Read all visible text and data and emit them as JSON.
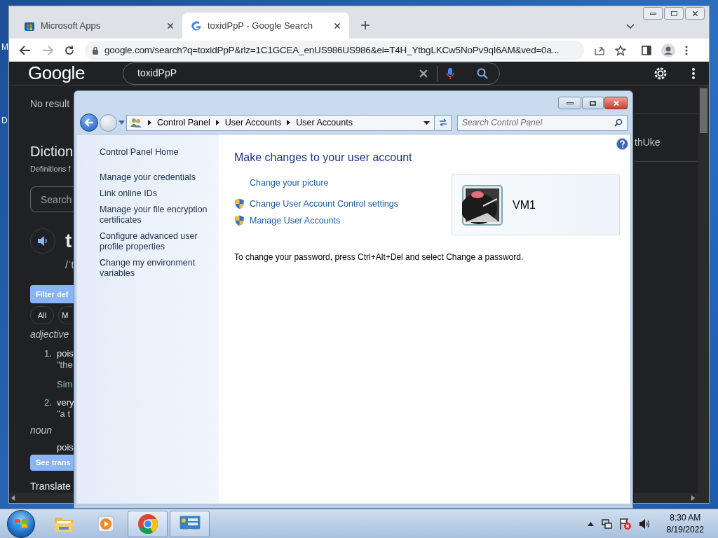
{
  "desktop": {
    "icon_labels": [
      "M",
      "D"
    ]
  },
  "browser": {
    "tabs": [
      {
        "label": "Microsoft Apps",
        "selected": false
      },
      {
        "label": "toxidPpP - Google Search",
        "selected": true
      }
    ],
    "url": "google.com/search?q=toxidPpP&rlz=1C1GCEA_enUS986US986&ei=T4H_YtbgLKCw5NoPv9qI6AM&ved=0a...",
    "logo": "Google",
    "search": {
      "value": "toxidPpP"
    },
    "page": {
      "no_results": "No result",
      "title": "Diction",
      "subtitle": "Definitions f",
      "search_placeholder": "Search",
      "word": "t",
      "phonetic": "/ˈt",
      "filter_button": "Filter def",
      "chips": [
        "All",
        "M"
      ],
      "senses": [
        {
          "pos": "adjective",
          "items": [
            {
              "number": "1.",
              "text": "pois",
              "example": "\"the",
              "similar": "Sim"
            },
            {
              "number": "2.",
              "text": "very",
              "example": "\"a t"
            }
          ]
        },
        {
          "pos": "noun",
          "items": [
            {
              "text": "pois"
            }
          ]
        }
      ],
      "translate_button": "See trans",
      "translate": "Translate",
      "side_text": "thUke"
    }
  },
  "control_panel": {
    "breadcrumb": [
      "Control Panel",
      "User Accounts",
      "User Accounts"
    ],
    "search_placeholder": "Search Control Panel",
    "sidebar": {
      "home": "Control Panel Home",
      "items": [
        "Manage your credentials",
        "Link online IDs",
        "Manage your file encryption certificates",
        "Configure advanced user profile properties",
        "Change my environment variables"
      ]
    },
    "heading": "Make changes to your user account",
    "links": [
      {
        "label": "Change your picture",
        "shield": false
      },
      {
        "label": "Change User Account Control settings",
        "shield": true
      },
      {
        "label": "Manage User Accounts",
        "shield": true
      }
    ],
    "note": "To change your password, press Ctrl+Alt+Del and select Change a password.",
    "account": {
      "name": "VM1"
    }
  },
  "taskbar": {
    "apps": [
      {
        "kind": "explorer",
        "selected": false
      },
      {
        "kind": "media",
        "selected": false
      },
      {
        "kind": "chrome",
        "selected": true
      },
      {
        "kind": "control-panel",
        "selected": true
      }
    ],
    "time": "8:30 AM",
    "date": "8/19/2022"
  }
}
